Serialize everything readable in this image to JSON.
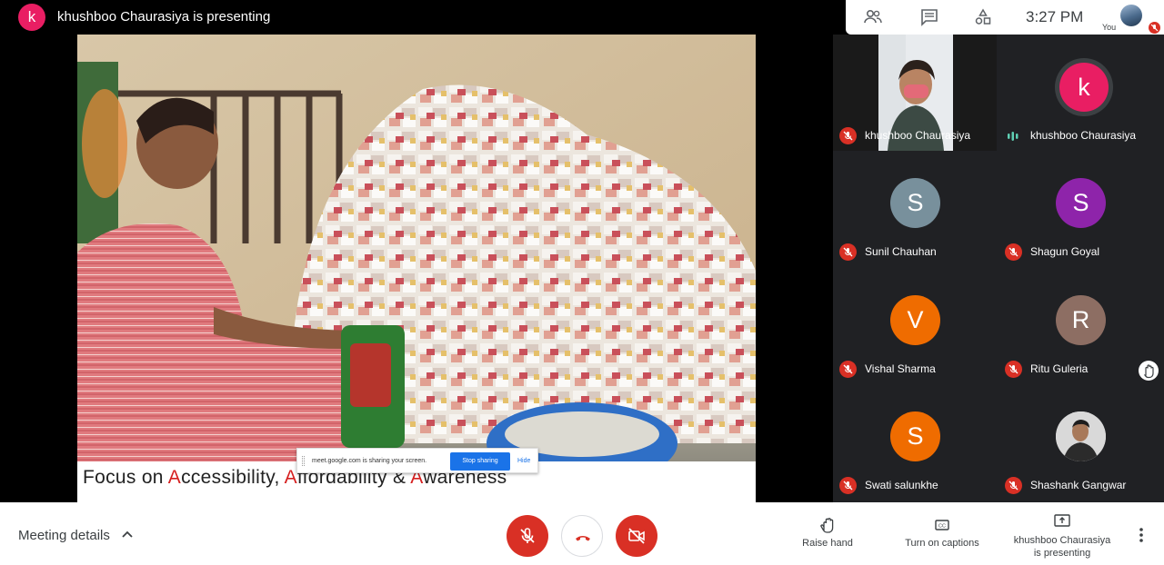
{
  "topbar": {
    "presenter_initial": "k",
    "presenter_title": "khushboo Chaurasiya is presenting",
    "icons": [
      "people-icon",
      "chat-icon",
      "activities-icon"
    ],
    "time": "3:27 PM",
    "self_label": "You"
  },
  "slide": {
    "caption_parts": [
      "Focus on ",
      "A",
      "ccessibility, ",
      "A",
      "ffordability & ",
      "A",
      "wareness"
    ],
    "share_text": "meet.google.com is sharing your screen.",
    "stop_sharing": "Stop sharing",
    "hide": "Hide"
  },
  "participants": [
    {
      "name": "khushboo Chaurasiya",
      "initial": "",
      "color": "",
      "muted": true,
      "video": true
    },
    {
      "name": "khushboo Chaurasiya",
      "initial": "k",
      "color": "#e91e63",
      "muted": false,
      "talking": true
    },
    {
      "name": "Sunil Chauhan",
      "initial": "S",
      "color": "#78909c",
      "muted": true
    },
    {
      "name": "Shagun Goyal",
      "initial": "S",
      "color": "#8e24aa",
      "muted": true
    },
    {
      "name": "Vishal Sharma",
      "initial": "V",
      "color": "#ef6c00",
      "muted": true
    },
    {
      "name": "Ritu Guleria",
      "initial": "R",
      "color": "#8d6e63",
      "muted": true,
      "hand_raised": true
    },
    {
      "name": "Swati salunkhe",
      "initial": "S",
      "color": "#ef6c00",
      "muted": true
    },
    {
      "name": "Shashank Gangwar",
      "initial": "",
      "color": "#e0e0e0",
      "muted": true,
      "photo": true
    }
  ],
  "bottombar": {
    "meeting_details": "Meeting details",
    "raise_hand": "Raise hand",
    "captions": "Turn on captions",
    "presenting_line1": "khushboo Chaurasiya",
    "presenting_line2": "is presenting"
  },
  "colors": {
    "accent_red": "#d93025",
    "blue": "#1a73e8",
    "tile_bg": "#202124"
  }
}
